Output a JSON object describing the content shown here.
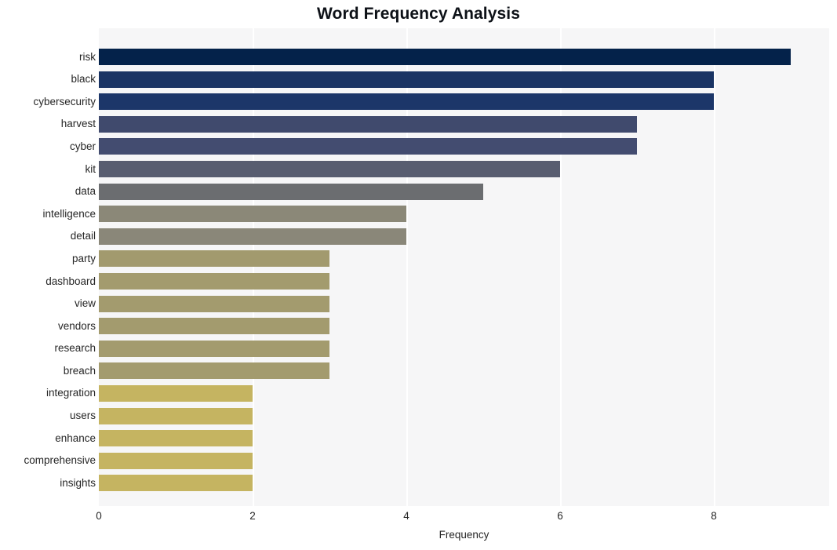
{
  "chart_data": {
    "type": "bar",
    "orientation": "horizontal",
    "title": "Word Frequency Analysis",
    "xlabel": "Frequency",
    "ylabel": "",
    "categories": [
      "risk",
      "black",
      "cybersecurity",
      "harvest",
      "cyber",
      "kit",
      "data",
      "intelligence",
      "detail",
      "party",
      "dashboard",
      "view",
      "vendors",
      "research",
      "breach",
      "integration",
      "users",
      "enhance",
      "comprehensive",
      "insights"
    ],
    "values": [
      9,
      8,
      8,
      7,
      7,
      6,
      5,
      4,
      4,
      3,
      3,
      3,
      3,
      3,
      3,
      2,
      2,
      2,
      2,
      2
    ],
    "bar_colors": [
      "#04224a",
      "#1a3464",
      "#1c3669",
      "#404a6d",
      "#434c70",
      "#585d70",
      "#6b6d70",
      "#8b8878",
      "#8a8779",
      "#a29a6e",
      "#a39b6e",
      "#a39b6e",
      "#a39b6e",
      "#a39b6e",
      "#a39b6e",
      "#c5b461",
      "#c5b461",
      "#c5b461",
      "#c5b461",
      "#c5b461"
    ],
    "xticks": [
      0,
      2,
      4,
      6,
      8
    ],
    "xtick_labels": [
      "0",
      "2",
      "4",
      "6",
      "8"
    ],
    "xlim": [
      0,
      9.5
    ],
    "ylim_count": 20,
    "grid": "vertical-only",
    "plot_background": "#f6f6f7",
    "figure_background": "#ffffff",
    "legend": null,
    "legend_position": "none"
  }
}
